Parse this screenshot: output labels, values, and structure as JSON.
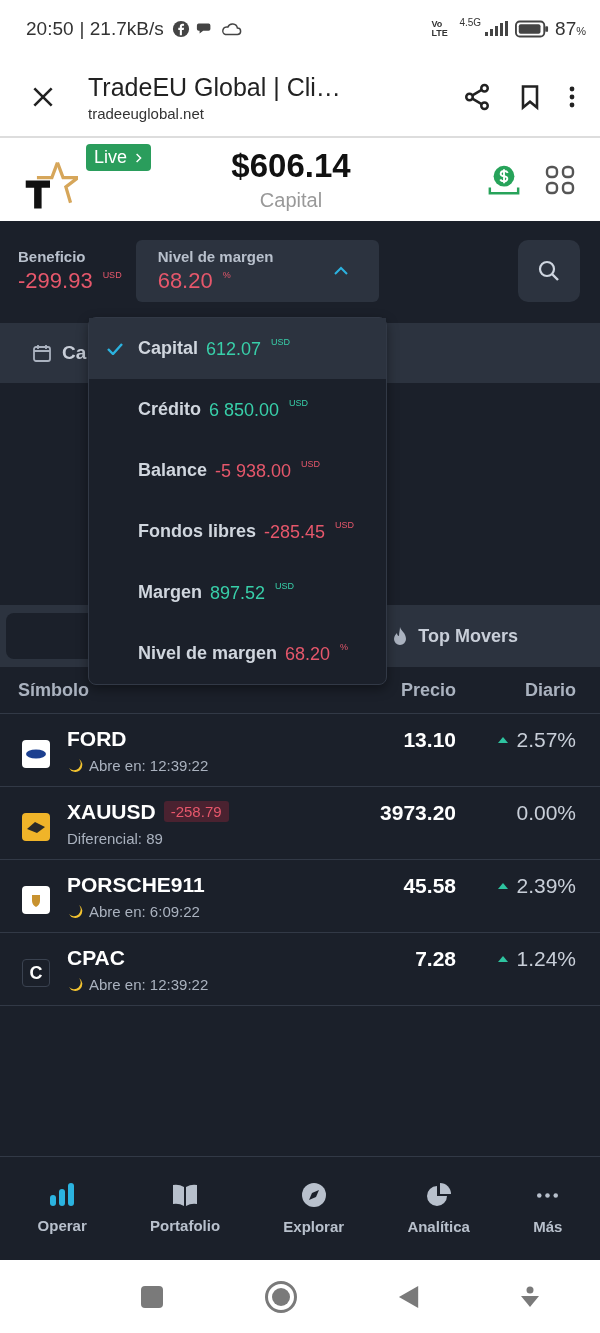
{
  "status_bar": {
    "time": "20:50",
    "speed": "| 21.7kB/s",
    "network": "4.5G",
    "volte": "Vo LTE",
    "battery": "87",
    "battery_unit": "%"
  },
  "browser": {
    "title": "TradeEU Global | Cli…",
    "url": "tradeeuglobal.net"
  },
  "header": {
    "live_badge": "Live",
    "amount": "$606.14",
    "amount_label": "Capital"
  },
  "metrics": {
    "profit": {
      "label": "Beneficio",
      "value": "-299.93",
      "unit": "USD"
    },
    "selector": {
      "label": "Nivel de margen",
      "value": "68.20",
      "unit": "%",
      "expanded": true
    }
  },
  "calendar_row": {
    "label": "Ca"
  },
  "dropdown": [
    {
      "label": "Capital",
      "value": "612.07",
      "unit": "USD",
      "kind": "gain",
      "selected": true
    },
    {
      "label": "Crédito",
      "value": "6 850.00",
      "unit": "USD",
      "kind": "gain",
      "selected": false
    },
    {
      "label": "Balance",
      "value": "-5 938.00",
      "unit": "USD",
      "kind": "loss",
      "selected": false
    },
    {
      "label": "Fondos libres",
      "value": "-285.45",
      "unit": "USD",
      "kind": "loss",
      "selected": false
    },
    {
      "label": "Margen",
      "value": "897.52",
      "unit": "USD",
      "kind": "gain",
      "selected": false
    },
    {
      "label": "Nivel de margen",
      "value": "68.20",
      "unit": "%",
      "kind": "loss",
      "selected": false
    }
  ],
  "tabs": [
    {
      "label": "Top Movers"
    }
  ],
  "table": {
    "columns": [
      "Símbolo",
      "Precio",
      "Diario"
    ],
    "rows": [
      {
        "symbol": "FORD",
        "kind": "closed",
        "sub": "Abre en: 12:39:22",
        "price": "13.10",
        "change": "2.57%"
      },
      {
        "symbol": "XAUUSD",
        "kind": "open",
        "badge": "-258.79",
        "sub": "Diferencial: 89",
        "price": "3973.20",
        "change": "0.00%"
      },
      {
        "symbol": "PORSCHE911",
        "kind": "closed",
        "sub": "Abre en: 6:09:22",
        "price": "45.58",
        "change": "2.39%"
      },
      {
        "symbol": "CPAC",
        "logo_text": "C",
        "kind": "closed",
        "sub": "Abre en: 12:39:22",
        "price": "7.28",
        "change": "1.24%"
      }
    ]
  },
  "bottom_nav": [
    {
      "label": "Operar",
      "selected": true
    },
    {
      "label": "Portafolio",
      "selected": false
    },
    {
      "label": "Explorar",
      "selected": false
    },
    {
      "label": "Analítica",
      "selected": false
    },
    {
      "label": "Más",
      "selected": false
    }
  ]
}
